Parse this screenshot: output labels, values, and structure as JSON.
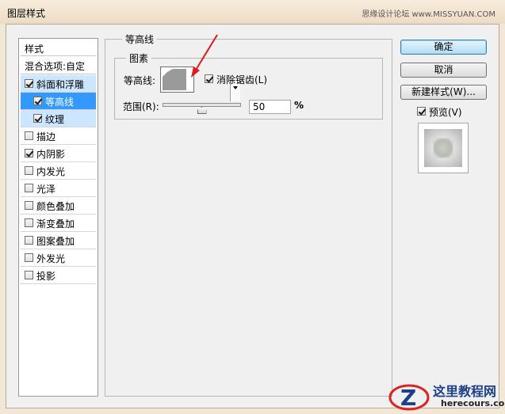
{
  "window": {
    "title": "图层样式",
    "watermark_top": "思缘设计论坛 www.MISSYUAN.COM"
  },
  "stylelist": {
    "header": "样式",
    "blend_options": "混合选项:自定",
    "items": [
      {
        "label": "斜面和浮雕",
        "checked": true
      },
      {
        "label": "等高线",
        "checked": true
      },
      {
        "label": "纹理",
        "checked": true
      },
      {
        "label": "描边",
        "checked": false
      },
      {
        "label": "内阴影",
        "checked": true
      },
      {
        "label": "内发光",
        "checked": false
      },
      {
        "label": "光泽",
        "checked": false
      },
      {
        "label": "颜色叠加",
        "checked": false
      },
      {
        "label": "渐变叠加",
        "checked": false
      },
      {
        "label": "图案叠加",
        "checked": false
      },
      {
        "label": "外发光",
        "checked": false
      },
      {
        "label": "投影",
        "checked": false
      }
    ]
  },
  "panel": {
    "group_title": "等高线",
    "subgroup_title": "图素",
    "contour_label": "等高线:",
    "antialias_label": "消除锯齿(L)",
    "antialias_checked": true,
    "range_label": "范围(R):",
    "range_value": "50",
    "range_unit": "%",
    "range_fraction": 0.5
  },
  "buttons": {
    "ok": "确定",
    "cancel": "取消",
    "new_style": "新建样式(W)...",
    "preview_label": "预览(V)",
    "preview_checked": true
  },
  "site_watermark": {
    "name": "这里教程网",
    "url": "herecours.com"
  },
  "colors": {
    "selection": "#3399ff",
    "highlight": "#cde6ff",
    "annotation_arrow": "#e11b1b",
    "default_button": "#b3ddf4"
  }
}
